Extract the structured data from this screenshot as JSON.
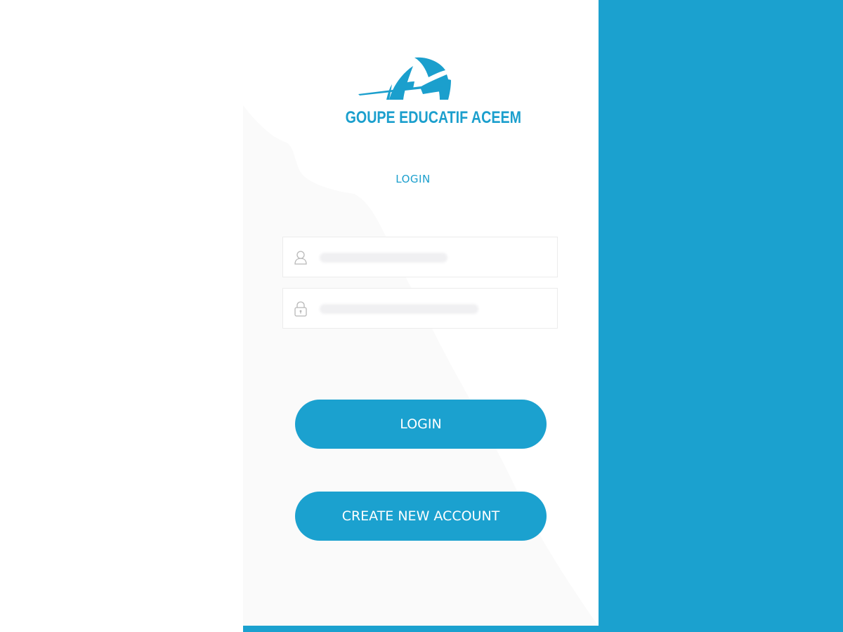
{
  "brand": {
    "name": "GOUPE EDUCATIF ACEEM",
    "color": "#1b9fcd"
  },
  "heading": "LOGIN",
  "form": {
    "username_icon": "user-icon",
    "username_placeholder": "",
    "username_value": "",
    "password_icon": "lock-icon",
    "password_placeholder": "",
    "password_value": ""
  },
  "buttons": {
    "login_label": "LOGIN",
    "create_account_label": "CREATE NEW ACCOUNT"
  },
  "colors": {
    "accent": "#1ba1cf",
    "card_background": "#fafafa",
    "page_background": "#ffffff"
  }
}
